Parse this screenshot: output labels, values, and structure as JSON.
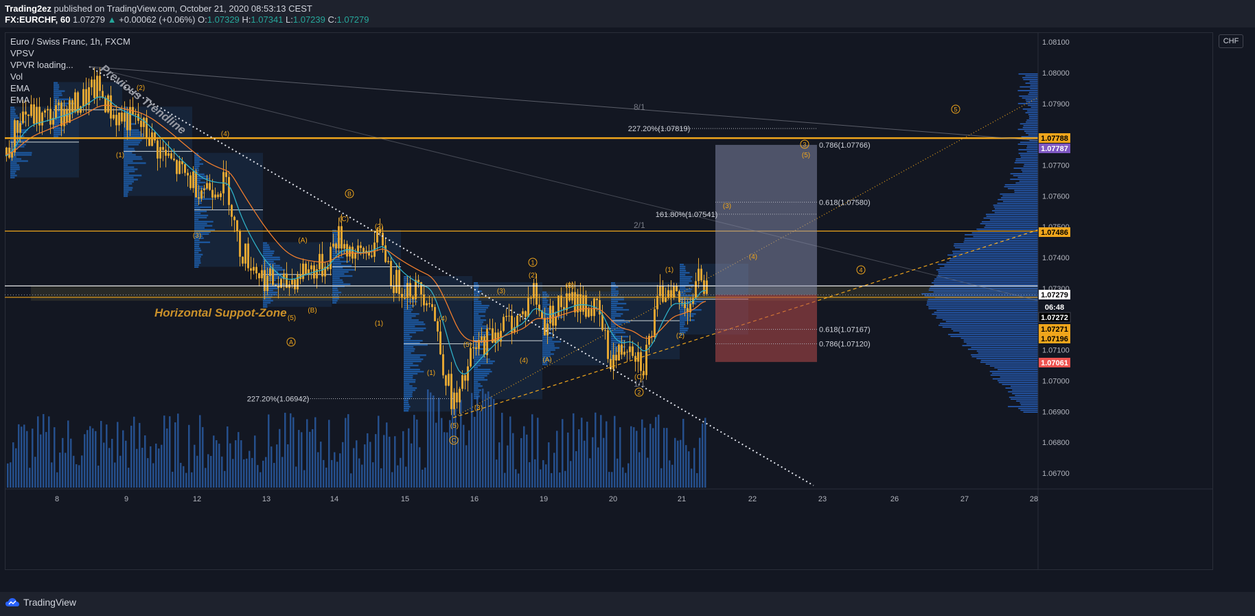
{
  "header": {
    "author": "Trading2ez",
    "published_text": "published on TradingView.com, October 21, 2020 08:53:13 CEST",
    "symbol": "FX:EURCHF, 60",
    "last": "1.07279",
    "change": "+0.00062 (+0.06%)",
    "o_label": "O:",
    "o_val": "1.07329",
    "h_label": "H:",
    "h_val": "1.07341",
    "l_label": "L:",
    "l_val": "1.07239",
    "c_label": "C:",
    "c_val": "1.07279"
  },
  "legend": {
    "title": "Euro / Swiss Franc, 1h, FXCM",
    "items": [
      "VPSV",
      "VPVR loading...",
      "Vol",
      "EMA",
      "EMA"
    ]
  },
  "currency_button": "CHF",
  "footer": {
    "brand": "TradingView"
  },
  "chart_data": {
    "type": "candlestick",
    "symbol": "EURCHF",
    "timeframe": "1h",
    "ylim": [
      1.0665,
      1.0812
    ],
    "x_ticks": [
      "8",
      "9",
      "12",
      "13",
      "14",
      "15",
      "16",
      "19",
      "20",
      "21",
      "22",
      "23",
      "26",
      "27",
      "28"
    ],
    "y_ticks": [
      "1.08100",
      "1.08000",
      "1.07900",
      "1.07700",
      "1.07600",
      "1.07500",
      "1.07400",
      "1.07300",
      "1.07100",
      "1.07000",
      "1.06900",
      "1.06800",
      "1.06700"
    ],
    "price_badges": [
      {
        "label": "1.07788",
        "color": "#f0a61c",
        "text": "#000000"
      },
      {
        "label": "1.07787",
        "color": "#7e57c2",
        "text": "#ffffff"
      },
      {
        "label": "1.07486",
        "color": "#f0a61c",
        "text": "#000000"
      },
      {
        "label": "1.07279",
        "color": "#ffffff",
        "text": "#000000"
      },
      {
        "label": "06:48",
        "color": "#131722",
        "text": "#ffffff"
      },
      {
        "label": "1.07272",
        "color": "#000000",
        "text": "#ffffff"
      },
      {
        "label": "1.07271",
        "color": "#f0a61c",
        "text": "#000000"
      },
      {
        "label": "1.07196",
        "color": "#f0a61c",
        "text": "#000000"
      },
      {
        "label": "1.07061",
        "color": "#ef5350",
        "text": "#ffffff"
      }
    ],
    "horizontal_levels": [
      {
        "price": 1.07788,
        "color": "#f0a61c"
      },
      {
        "price": 1.07486,
        "color": "#f0a61c"
      },
      {
        "price": 1.07308,
        "color": "#ffffff"
      },
      {
        "price": 1.07271,
        "color": "#f0a61c"
      }
    ],
    "annotations": {
      "previous_trendline": "Previous Trendline",
      "support_zone": "Horizontal Suppot-Zone",
      "fib_227_top": "227.20%(1.07819)",
      "fib_161": "161.80%(1.07541)",
      "fib_227_bottom": "227.20%(1.06942)",
      "ret_786_top": "0.786(1.07766)",
      "ret_618_top": "0.618(1.07580)",
      "ret_618_bot": "0.618(1.07167)",
      "ret_786_bot": "0.786(1.07120)",
      "fan_8_1": "8/1",
      "fan_2_1": "2/1",
      "fan_1_1": "1/1"
    },
    "wave_labels": [
      "(2)",
      "(4)",
      "(1)",
      "(3)",
      "(A)",
      "(B)",
      "(5)",
      "(C)",
      "(2)",
      "(1)",
      "(4)",
      "(3)",
      "(5)",
      "(1)",
      "(2)",
      "(3)",
      "(4)",
      "(A)",
      "(B)",
      "(5)",
      "(1)",
      "(2)",
      "(C)",
      "(3)",
      "(4)",
      "(5)",
      "(1)",
      "(2)",
      "(3)",
      "(4)",
      "(5)"
    ],
    "circle_labels": [
      "B",
      "A",
      "1",
      "C",
      "2",
      "3",
      "4",
      "5"
    ],
    "colors": {
      "bullish": "#e2a533",
      "ema_fast": "#2fb0c7",
      "ema_slow": "#f07d2d",
      "volume": "#2962ff",
      "profile": "#1e63b5",
      "wave": "#f0a61c"
    }
  }
}
